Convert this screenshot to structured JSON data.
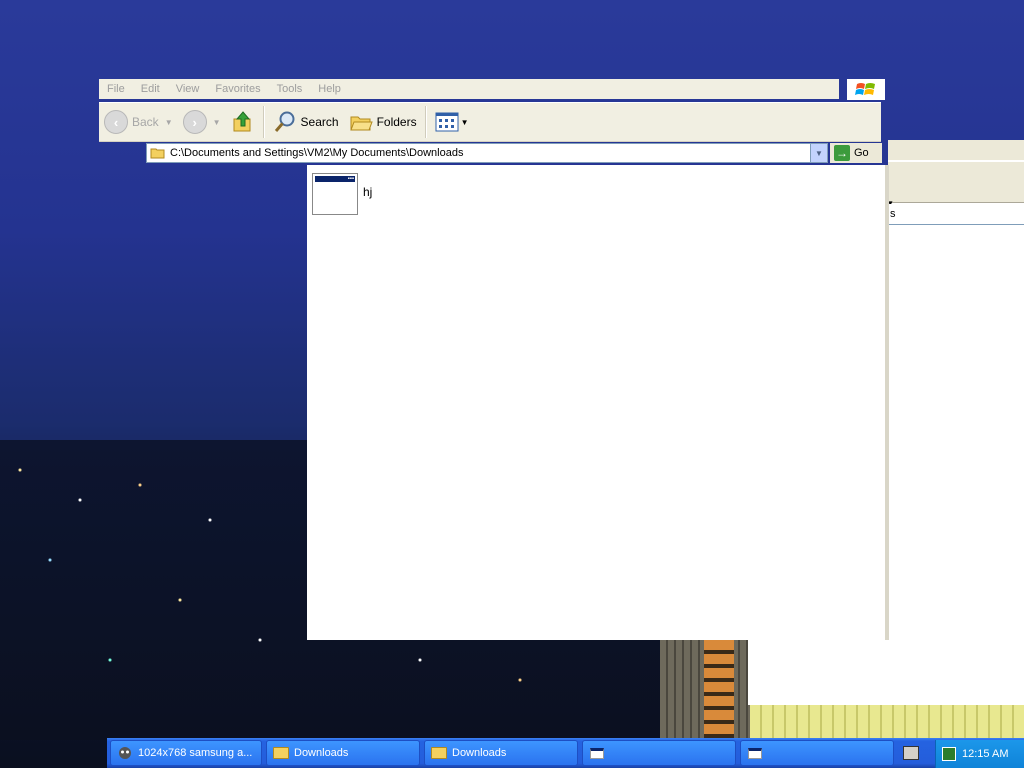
{
  "menu": {
    "items": [
      "File",
      "Edit",
      "View",
      "Favorites",
      "Tools",
      "Help"
    ]
  },
  "toolbar": {
    "back_label": "Back",
    "search_label": "Search",
    "folders_label": "Folders"
  },
  "address": {
    "path": "C:\\Documents and Settings\\VM2\\My Documents\\Downloads",
    "go_label": "Go"
  },
  "files": [
    {
      "name": "hj",
      "icon": "application-window-icon"
    }
  ],
  "background_window": {
    "address_fragment": "s"
  },
  "taskbar": {
    "items": [
      {
        "label": "1024x768 samsung a...",
        "icon": "app-icon"
      },
      {
        "label": "Downloads",
        "icon": "folder-icon"
      },
      {
        "label": "Downloads",
        "icon": "folder-icon"
      },
      {
        "label": "",
        "icon": "window-icon"
      },
      {
        "label": "",
        "icon": "window-icon"
      }
    ],
    "clock": "12:15 AM"
  },
  "colors": {
    "taskbar_blue": "#245ddb",
    "tray_blue": "#0f83d8",
    "menu_bg": "#f1efe2"
  }
}
